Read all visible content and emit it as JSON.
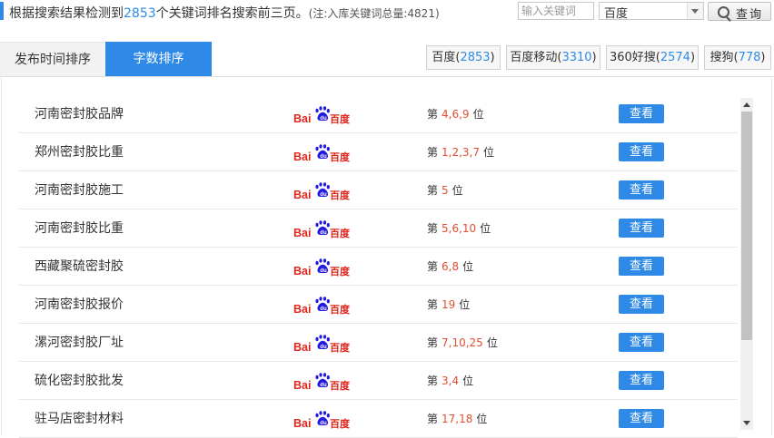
{
  "summary": {
    "prefix": "根据搜索结果检测到",
    "count": "2853",
    "suffix": "个关键词排名搜索前三页。",
    "note": "(注:入库关键词总量:4821)"
  },
  "search": {
    "placeholder": "输入关键词",
    "engine_value": "百度",
    "button_label": "查询"
  },
  "tabs": [
    {
      "label": "发布时间排序"
    },
    {
      "label": "字数排序"
    }
  ],
  "engines": [
    {
      "name": "百度",
      "count": "2853"
    },
    {
      "name": "百度移动",
      "count": "3310"
    },
    {
      "name": "360好搜",
      "count": "2574"
    },
    {
      "name": "搜狗",
      "count": "778"
    }
  ],
  "rank_prefix": "第",
  "rank_suffix": "位",
  "view_label": "查看",
  "logo": {
    "part1": "Bai",
    "part2": "百度",
    "color_red": "#e1251b",
    "color_blue": "#2319dc"
  },
  "colors": {
    "accent": "#2e8ae6",
    "rank": "#e05030"
  },
  "rows": [
    {
      "keyword": "河南密封胶品牌",
      "positions": "4,6,9"
    },
    {
      "keyword": "郑州密封胶比重",
      "positions": "1,2,3,7"
    },
    {
      "keyword": "河南密封胶施工",
      "positions": "5"
    },
    {
      "keyword": "河南密封胶比重",
      "positions": "5,6,10"
    },
    {
      "keyword": "西藏聚硫密封胶",
      "positions": "6,8"
    },
    {
      "keyword": "河南密封胶报价",
      "positions": "19"
    },
    {
      "keyword": "漯河密封胶厂址",
      "positions": "7,10,25"
    },
    {
      "keyword": "硫化密封胶批发",
      "positions": "3,4"
    },
    {
      "keyword": "驻马店密封材料",
      "positions": "17,18"
    }
  ]
}
